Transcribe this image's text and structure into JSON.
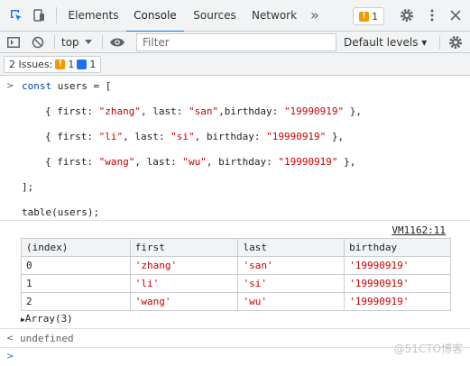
{
  "tabs": {
    "items": [
      {
        "label": "Elements",
        "active": false
      },
      {
        "label": "Console",
        "active": true
      },
      {
        "label": "Sources",
        "active": false
      },
      {
        "label": "Network",
        "active": false
      }
    ],
    "more": "»",
    "issue_count": "1"
  },
  "toolbar": {
    "context": "top",
    "filter_placeholder": "Filter",
    "levels": "Default levels ▾"
  },
  "issues_bar": {
    "label": "2 Issues:",
    "warnings": "1",
    "infos": "1"
  },
  "console": {
    "code": {
      "l1_kw": "const",
      "l1_rest": " users = [",
      "rows": [
        {
          "first": "\"zhang\"",
          "last": "\"san\"",
          "birthday": "\"19990919\"",
          "sep_after_last": ",birthday: "
        },
        {
          "first": "\"li\"",
          "last": "\"si\"",
          "birthday": "\"19990919\"",
          "sep_after_last": ", birthday: "
        },
        {
          "first": "\"wang\"",
          "last": "\"wu\"",
          "birthday": "\"19990919\"",
          "sep_after_last": ", birthday: "
        }
      ],
      "close": "];",
      "call": "table(users);"
    },
    "source_link": "VM1162:11",
    "table": {
      "headers": [
        "(index)",
        "first",
        "last",
        "birthday"
      ],
      "rows": [
        [
          "0",
          "'zhang'",
          "'san'",
          "'19990919'"
        ],
        [
          "1",
          "'li'",
          "'si'",
          "'19990919'"
        ],
        [
          "2",
          "'wang'",
          "'wu'",
          "'19990919'"
        ]
      ]
    },
    "array_summary": "Array(3)",
    "result": "undefined"
  },
  "watermark": "@51CTO博客",
  "colors": {
    "accent": "#1a73e8",
    "warning": "#f29900",
    "string": "#c80000",
    "keyword": "#0842a0"
  }
}
